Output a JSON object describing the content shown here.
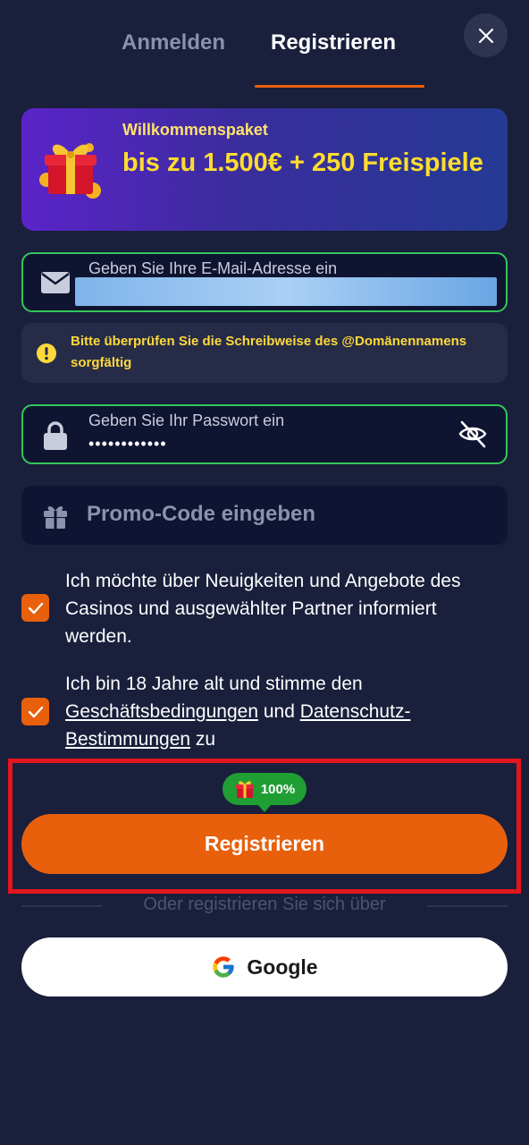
{
  "tabs": {
    "login_label": "Anmelden",
    "register_label": "Registrieren"
  },
  "close": {
    "icon": "close-icon"
  },
  "banner": {
    "subtitle": "Willkommenspaket",
    "title": "bis zu 1.500€ + 250 Freispiele",
    "icon": "gift-icon"
  },
  "email": {
    "label": "Geben Sie Ihre E-Mail-Adresse ein",
    "icon": "mail-icon"
  },
  "warning": {
    "text": "Bitte überprüfen Sie die Schreibweise des @Domänennamens sorgfältig",
    "icon": "warning-icon"
  },
  "password": {
    "label": "Geben Sie Ihr Passwort ein",
    "value": "••••••••••••",
    "icon": "lock-icon",
    "toggle_icon": "eye-off-icon"
  },
  "promo": {
    "placeholder": "Promo-Code eingeben",
    "icon": "gift-icon"
  },
  "consent_news": {
    "checked": true,
    "text": "Ich möchte über Neuigkeiten und Angebote des Casinos und ausgewählter Partner informiert werden."
  },
  "consent_age": {
    "checked": true,
    "text_before": "Ich bin 18 Jahre alt und stimme den ",
    "terms_link": "Geschäftsbedingungen",
    "text_middle": " und ",
    "privacy_link": "Datenschutz-Bestimmungen",
    "text_after": " zu"
  },
  "bonus_badge": {
    "percent": "100%",
    "icon": "gift-icon"
  },
  "register_button": {
    "label": "Registrieren"
  },
  "divider": {
    "text": "Oder registrieren Sie sich über"
  },
  "google_button": {
    "label": "Google",
    "icon": "google-icon"
  },
  "colors": {
    "background": "#1a1f3c",
    "accent": "#e8600c",
    "valid": "#34c759",
    "warning_text": "#ffd83a",
    "badge": "#1f9e33",
    "highlight": "#e4151d"
  }
}
